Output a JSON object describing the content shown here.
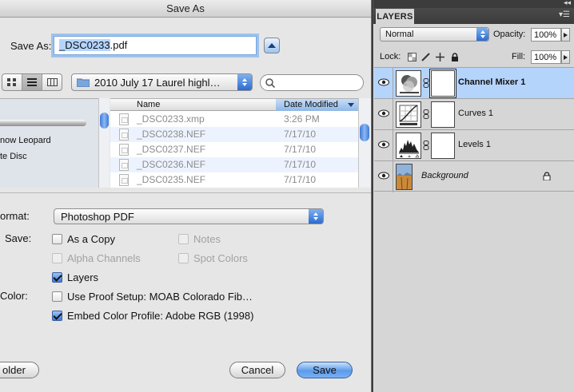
{
  "dialog": {
    "title": "Save As",
    "save_as_label": "Save As:",
    "filename_base": "_DSC0233",
    "filename_ext": ".pdf",
    "location": "2010 July 17 Laurel highl…",
    "sidebar": {
      "items": [
        "now Leopard",
        "te Disc"
      ]
    },
    "file_list": {
      "col_name": "Name",
      "col_date": "Date Modified",
      "rows": [
        {
          "name": "_DSC0233.xmp",
          "date": "3:26 PM"
        },
        {
          "name": "_DSC0238.NEF",
          "date": "7/17/10"
        },
        {
          "name": "_DSC0237.NEF",
          "date": "7/17/10"
        },
        {
          "name": "_DSC0236.NEF",
          "date": "7/17/10"
        },
        {
          "name": "_DSC0235.NEF",
          "date": "7/17/10"
        }
      ]
    },
    "options": {
      "format_label": "ormat:",
      "format_value": "Photoshop PDF",
      "save_label": "Save:",
      "as_copy": "As a Copy",
      "notes": "Notes",
      "alpha_channels": "Alpha Channels",
      "spot_colors": "Spot Colors",
      "layers": "Layers",
      "color_label": "Color:",
      "use_proof_setup": "Use Proof Setup:  MOAB Colorado Fib…",
      "embed_color_profile": "Embed Color Profile:  Adobe RGB (1998)"
    },
    "buttons": {
      "new_folder": "older",
      "cancel": "Cancel",
      "save": "Save"
    }
  },
  "layers_panel": {
    "tab": "LAYERS",
    "blend_mode": "Normal",
    "opacity_label": "Opacity:",
    "opacity_value": "100%",
    "lock_label": "Lock:",
    "fill_label": "Fill:",
    "fill_value": "100%",
    "layers": [
      {
        "name": "Channel Mixer 1",
        "selected": true
      },
      {
        "name": "Curves 1",
        "selected": false
      },
      {
        "name": "Levels 1",
        "selected": false
      },
      {
        "name": "Background",
        "selected": false
      }
    ]
  },
  "colors": {
    "selection_blue": "#b5d4fb",
    "accent_blue": "#3a7ad9",
    "panel_dark": "#3b3b3b"
  }
}
